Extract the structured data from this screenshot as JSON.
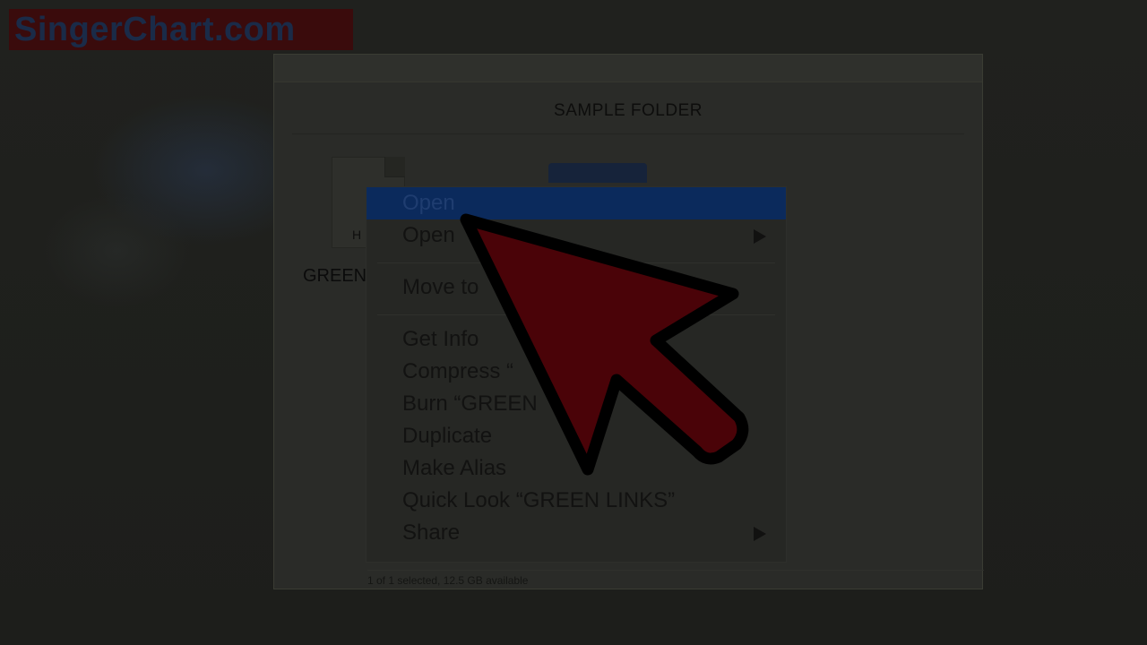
{
  "watermark": {
    "text": "SingerChart.com"
  },
  "finder": {
    "title": "SAMPLE FOLDER",
    "file": {
      "ext_label": "H",
      "name_label": "GREEN"
    },
    "status_text": "1 of 1 selected, 12.5 GB available"
  },
  "context_menu": {
    "items": [
      {
        "label": "Open",
        "selected": true
      },
      {
        "label": "Open",
        "submenu": true
      },
      {
        "label": "Move to"
      },
      {
        "label": "Get Info"
      },
      {
        "label": "Compress “"
      },
      {
        "label": "Burn “GREEN"
      },
      {
        "label": "Duplicate"
      },
      {
        "label": "Make Alias"
      },
      {
        "label": "Quick Look “GREEN LINKS”"
      },
      {
        "label": "Share",
        "submenu": true
      }
    ]
  },
  "overlay": {
    "pointer": "mouse-pointer-arrow-icon",
    "color": "#4a0308",
    "outline": "#000000"
  }
}
